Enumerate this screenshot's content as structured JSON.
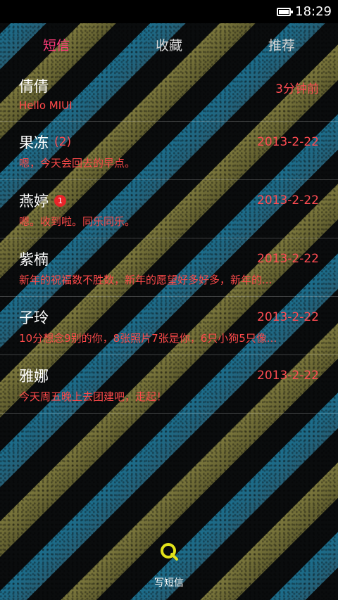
{
  "status": {
    "time": "18:29"
  },
  "tabs": [
    {
      "label": "短信"
    },
    {
      "label": "收藏"
    },
    {
      "label": "推荐"
    }
  ],
  "messages": [
    {
      "name": "倩倩",
      "count": "",
      "badge": "",
      "time": "3分钟前",
      "preview": "Hello MIUI"
    },
    {
      "name": "果冻",
      "count": "(2)",
      "badge": "",
      "time": "2013-2-22",
      "preview": "嗯，今天会回去的早点。"
    },
    {
      "name": "燕婷",
      "count": "",
      "badge": "1",
      "time": "2013-2-22",
      "preview": "嗯。收到啦。同乐同乐。"
    },
    {
      "name": "紫楠",
      "count": "",
      "badge": "",
      "time": "2013-2-22",
      "preview": "新年的祝福数不胜数，新年的愿望好多好多，新年的..."
    },
    {
      "name": "子玲",
      "count": "",
      "badge": "",
      "time": "2013-2-22",
      "preview": "10分想念9别的你，8张照片7张是你，6只小狗5只像..."
    },
    {
      "name": "雅娜",
      "count": "",
      "badge": "",
      "time": "2013-2-22",
      "preview": "今天周五晚上去团建吧，走起！"
    }
  ],
  "compose": {
    "label": "写短信",
    "icon": "compose-message-icon"
  },
  "colors": {
    "accent": "#ff3b7a",
    "time": "#ff4c52",
    "preview": "#ff4a4a",
    "badge": "#e8252a",
    "compose_icon": "#e3e31a"
  }
}
